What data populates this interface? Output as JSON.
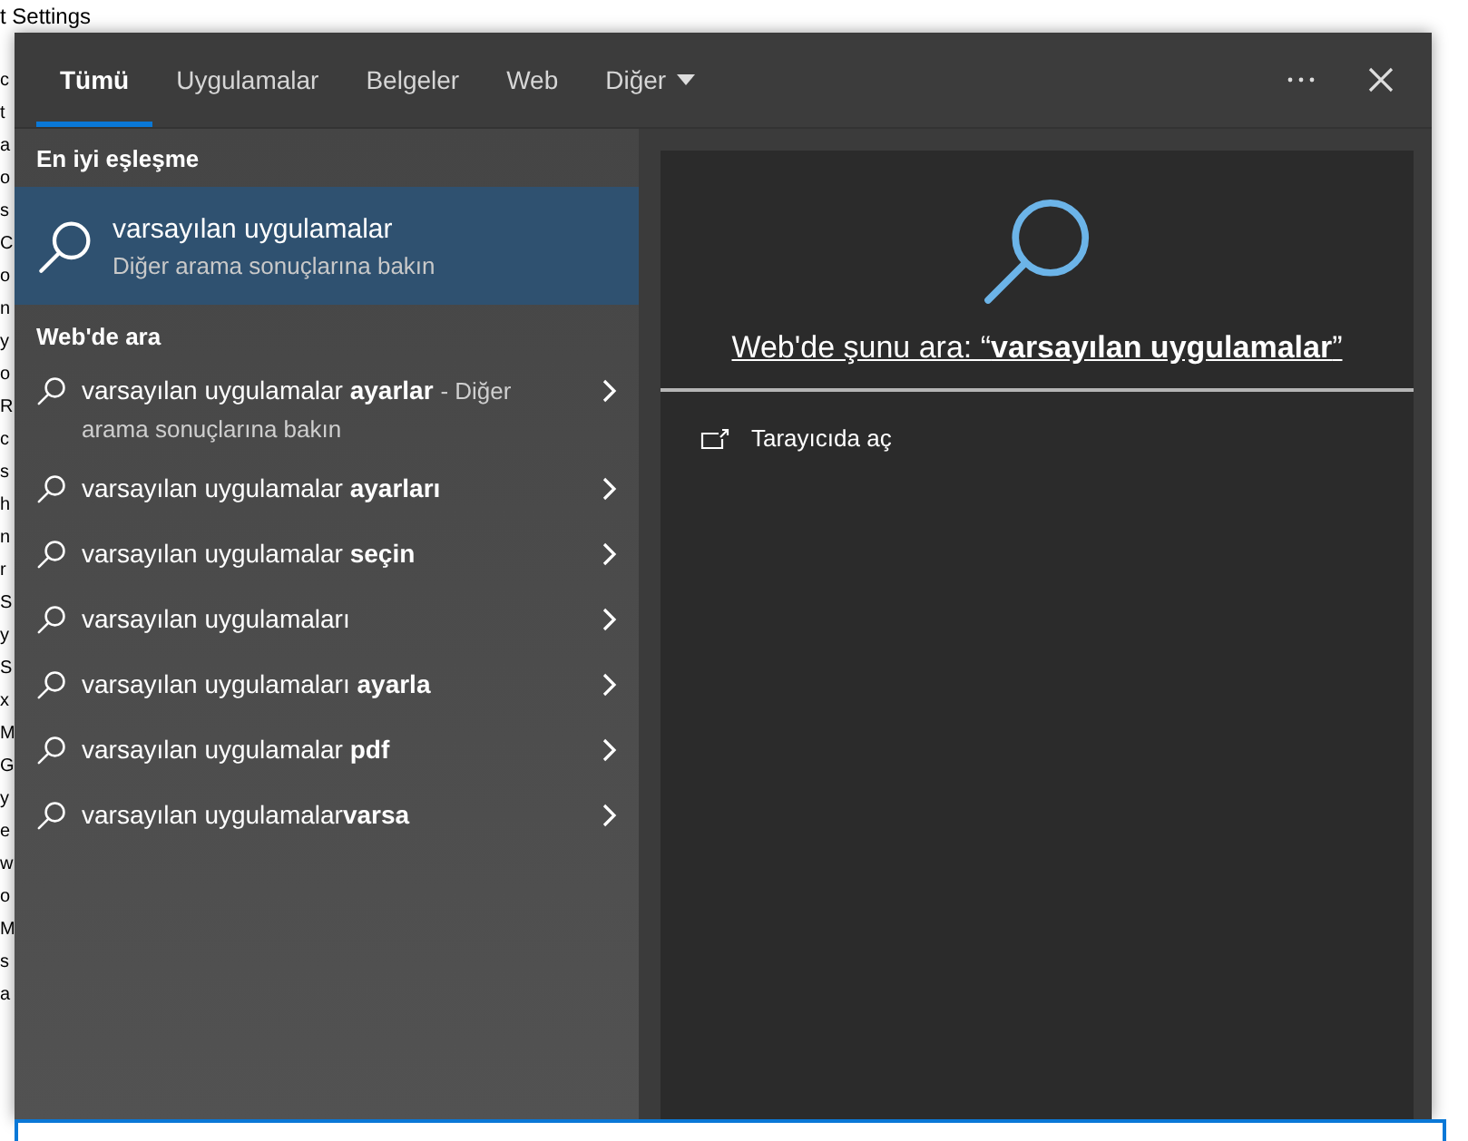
{
  "background_window": {
    "lines": [
      "t Settings",
      "c",
      "t",
      "a",
      "o",
      "s",
      "C",
      "o",
      "n",
      "y",
      "o",
      "R",
      "c",
      "s",
      "h",
      "n",
      "r",
      "S",
      "y",
      "S",
      "x",
      "M",
      "G",
      "y",
      "e",
      "w",
      "o",
      "M",
      "s",
      "a"
    ]
  },
  "tabs": [
    {
      "label": "Tümü",
      "selected": true,
      "kind": "plain"
    },
    {
      "label": "Uygulamalar",
      "selected": false,
      "kind": "plain"
    },
    {
      "label": "Belgeler",
      "selected": false,
      "kind": "plain"
    },
    {
      "label": "Web",
      "selected": false,
      "kind": "plain"
    },
    {
      "label": "Diğer",
      "selected": false,
      "kind": "dropdown"
    }
  ],
  "best_match": {
    "heading": "En iyi eşleşme",
    "title": "varsayılan uygulamalar",
    "subtitle": "Diğer arama sonuçlarına bakın",
    "selected": true
  },
  "web_section": {
    "heading": "Web'de ara",
    "results": [
      {
        "text": "varsayılan uygulamalar **ayarlar**",
        "note": "- Diğer arama sonuçlarına bakın"
      },
      {
        "text": "varsayılan uygulamalar **ayarları**"
      },
      {
        "text": "varsayılan uygulamalar **seçin**"
      },
      {
        "text": "varsayılan uygulamaları"
      },
      {
        "text": "varsayılan uygulamaları **ayarla**"
      },
      {
        "text": "varsayılan uygulamalar **pdf**"
      },
      {
        "text": "varsayılan uygulamalar**varsa**"
      }
    ]
  },
  "preview": {
    "prompt": "Web'de şunu ara: “**varsayılan uygulamalar**”",
    "action": "Tarayıcıda aç"
  }
}
